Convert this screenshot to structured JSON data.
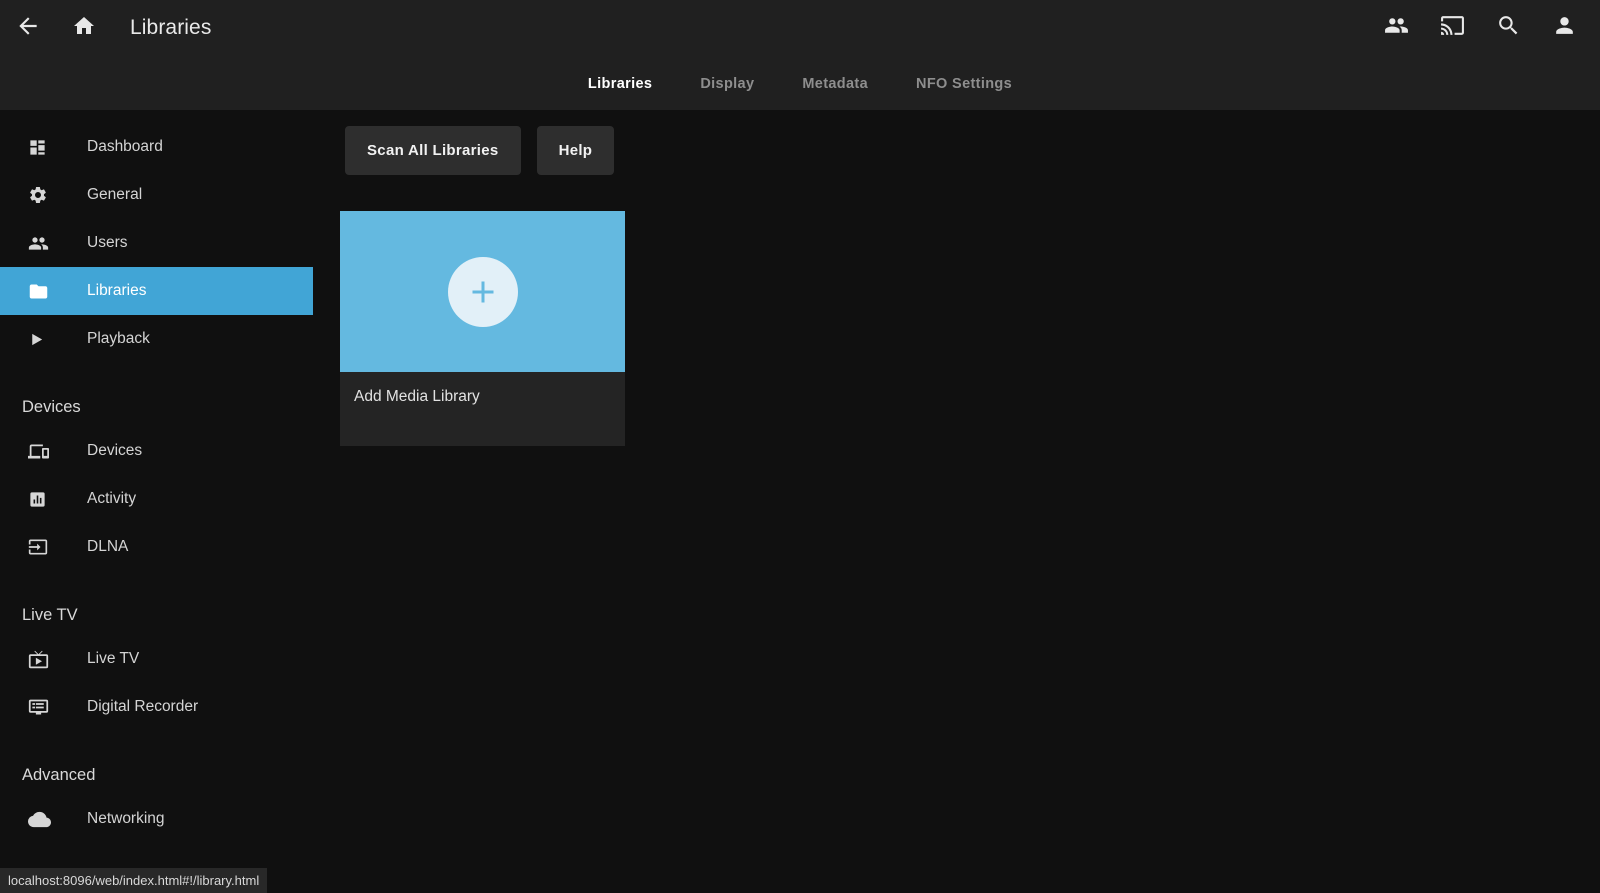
{
  "header": {
    "title": "Libraries",
    "back_icon": "arrow-left-icon",
    "home_icon": "home-icon",
    "right_icons": [
      {
        "name": "group-icon"
      },
      {
        "name": "cast-icon"
      },
      {
        "name": "search-icon"
      },
      {
        "name": "user-account-icon"
      }
    ]
  },
  "tabs": [
    {
      "label": "Libraries",
      "active": true
    },
    {
      "label": "Display",
      "active": false
    },
    {
      "label": "Metadata",
      "active": false
    },
    {
      "label": "NFO Settings",
      "active": false
    }
  ],
  "sidebar": {
    "items": [
      {
        "label": "Dashboard",
        "icon": "dashboard-grid-icon",
        "active": false
      },
      {
        "label": "General",
        "icon": "gear-icon",
        "active": false
      },
      {
        "label": "Users",
        "icon": "people-icon",
        "active": false
      },
      {
        "label": "Libraries",
        "icon": "folder-icon",
        "active": true
      },
      {
        "label": "Playback",
        "icon": "play-triangle-icon",
        "active": false
      }
    ],
    "devices_heading": "Devices",
    "devices_items": [
      {
        "label": "Devices",
        "icon": "devices-icon"
      },
      {
        "label": "Activity",
        "icon": "activity-chart-icon"
      },
      {
        "label": "DLNA",
        "icon": "dlna-input-icon"
      }
    ],
    "livetv_heading": "Live TV",
    "livetv_items": [
      {
        "label": "Live TV",
        "icon": "tv-icon"
      },
      {
        "label": "Digital Recorder",
        "icon": "dvr-icon"
      }
    ],
    "advanced_heading": "Advanced",
    "advanced_items": [
      {
        "label": "Networking",
        "icon": "cloud-icon"
      }
    ]
  },
  "toolbar": {
    "scan_label": "Scan All Libraries",
    "help_label": "Help"
  },
  "library_card": {
    "label": "Add Media Library",
    "icon": "plus-icon",
    "accent_color": "#64b9e0"
  },
  "status_bar": {
    "url": "localhost:8096/web/index.html#!/library.html"
  },
  "colors": {
    "background": "#101010",
    "header": "#202020",
    "accent": "#41a5d6",
    "card_accent": "#64b9e0",
    "button": "#2e2e2e"
  }
}
